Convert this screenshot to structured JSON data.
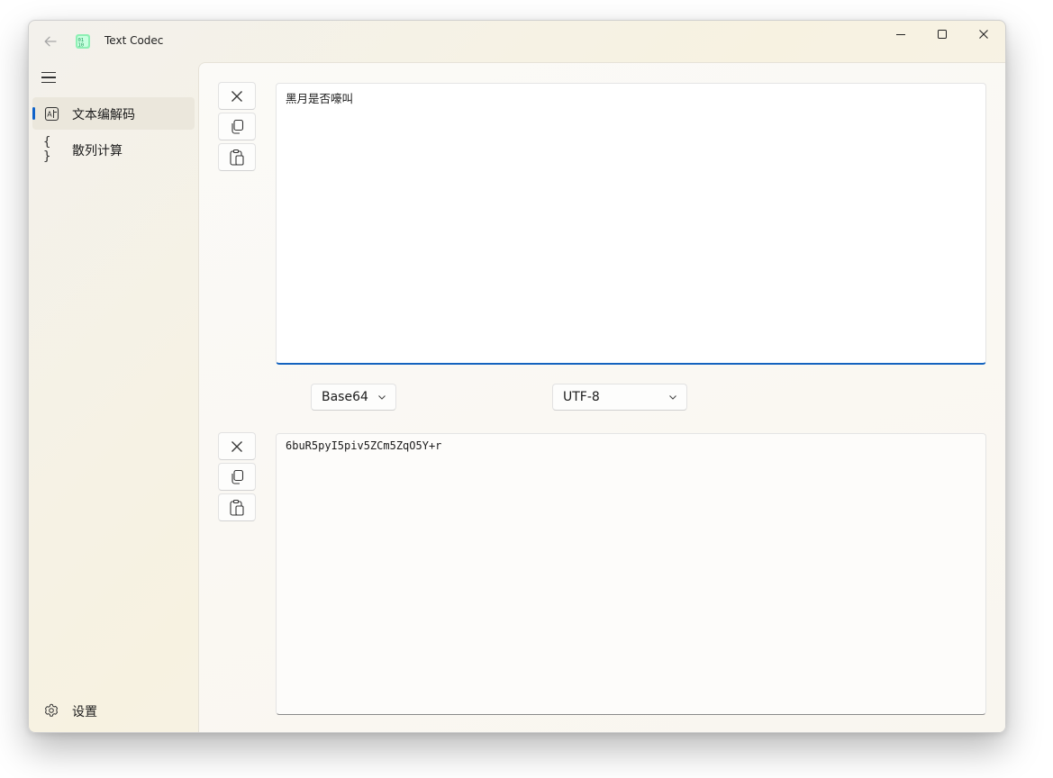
{
  "window": {
    "title": "Text Codec"
  },
  "sidebar": {
    "items": [
      {
        "label": "文本编解码",
        "icon": "text-translate-icon",
        "selected": true
      },
      {
        "label": "散列计算",
        "icon": "braces-icon",
        "selected": false
      }
    ],
    "settings_label": "设置"
  },
  "editor": {
    "input_text": "黑月是否嚎叫",
    "output_text": "6buR5pyI5piv5ZCm5ZqO5Y+r",
    "codec": "Base64",
    "encoding": "UTF-8"
  },
  "colors": {
    "accent": "#0f62c9"
  }
}
